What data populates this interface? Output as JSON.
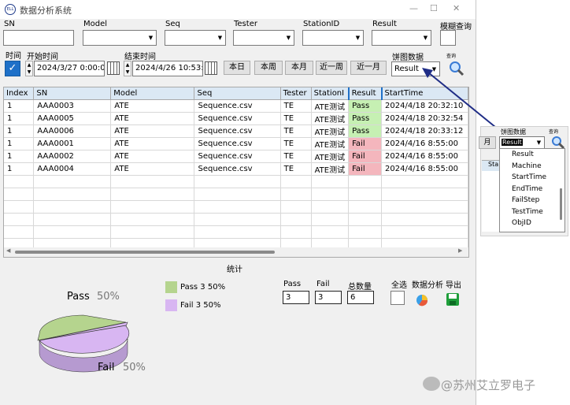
{
  "window": {
    "title": "数据分析系统",
    "logo": "ELL"
  },
  "filters": {
    "sn_label": "SN",
    "model_label": "Model",
    "seq_label": "Seq",
    "tester_label": "Tester",
    "station_label": "StationID",
    "result_label": "Result",
    "fuzzy_label": "模糊查询"
  },
  "time": {
    "time_label": "时间",
    "start_label": "开始时间",
    "start_value": "2024/3/27 0:00:00",
    "end_label": "结束时间",
    "end_value": "2024/4/26 10:53:30",
    "buttons": [
      "本日",
      "本周",
      "本月",
      "近一周",
      "近一月"
    ],
    "pie_label": "饼图数据",
    "pie_value": "Result",
    "query_label": "查询"
  },
  "table": {
    "columns": [
      "Index",
      "SN",
      "Model",
      "Seq",
      "Tester",
      "StationI",
      "Result",
      "StartTime"
    ],
    "rows": [
      [
        "1",
        "AAA0003",
        "ATE",
        "Sequence.csv",
        "TE",
        "ATE测试",
        "Pass",
        "2024/4/18 20:32:10"
      ],
      [
        "1",
        "AAA0005",
        "ATE",
        "Sequence.csv",
        "TE",
        "ATE测试",
        "Pass",
        "2024/4/18 20:32:54"
      ],
      [
        "1",
        "AAA0006",
        "ATE",
        "Sequence.csv",
        "TE",
        "ATE测试",
        "Pass",
        "2024/4/18 20:33:12"
      ],
      [
        "1",
        "AAA0001",
        "ATE",
        "Sequence.csv",
        "TE",
        "ATE测试",
        "Fail",
        "2024/4/16 8:55:00"
      ],
      [
        "1",
        "AAA0002",
        "ATE",
        "Sequence.csv",
        "TE",
        "ATE测试",
        "Fail",
        "2024/4/16 8:55:00"
      ],
      [
        "1",
        "AAA0004",
        "ATE",
        "Sequence.csv",
        "TE",
        "ATE测试",
        "Fail",
        "2024/4/16 8:55:00"
      ]
    ]
  },
  "stats": {
    "title": "统计",
    "legend": [
      {
        "label": "Pass 3 50%",
        "color": "#b5d48e"
      },
      {
        "label": "Fail 3 50%",
        "color": "#d8b6f2"
      }
    ],
    "pass_label": "Pass",
    "fail_label": "Fail",
    "total_label": "总数量",
    "pass_value": "3",
    "fail_value": "3",
    "total_value": "6",
    "select_all_label": "全选",
    "analysis_label": "数据分析",
    "export_label": "导出",
    "pie_pass_name": "Pass",
    "pie_pass_pct": "50%",
    "pie_fail_name": "Fail",
    "pie_fail_pct": "50%"
  },
  "popup": {
    "pie_label": "饼图数据",
    "query_label": "查询",
    "month_btn": "月",
    "value": "Result",
    "col_stub": "Sta",
    "options": [
      "Result",
      "Machine",
      "StartTime",
      "EndTime",
      "FailStep",
      "TestTime",
      "ObjID"
    ]
  },
  "watermark": "@苏州艾立罗电子",
  "colors": {
    "pass": "#c6f0b3",
    "fail": "#f4b6bd",
    "header": "#dbe8f4",
    "arrow": "#1f2d86",
    "checkbox": "#1e70c8",
    "export": "#1e9e3a"
  }
}
